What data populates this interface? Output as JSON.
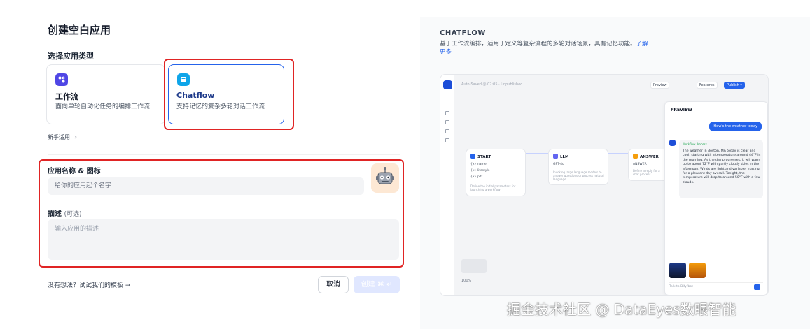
{
  "left": {
    "title": "创建空白应用",
    "type_label": "选择应用类型",
    "cards": [
      {
        "name": "工作流",
        "desc": "面向单轮自动化任务的编排工作流",
        "icon": "workflow-icon",
        "selected": false
      },
      {
        "name": "Chatflow",
        "desc": "支持记忆的复杂多轮对话工作流",
        "icon": "chatflow-icon",
        "selected": true
      }
    ],
    "beginner": "新手适用",
    "name_label": "应用名称 & 图标",
    "name_placeholder": "给你的应用起个名字",
    "avatar_icon": "robot-icon",
    "desc_label": "描述",
    "desc_optional": "(可选)",
    "desc_placeholder": "输入应用的描述",
    "template_link": "没有想法？试试我们的模板 →",
    "cancel": "取消",
    "create": "创建 ⌘ ↵"
  },
  "right": {
    "title": "CHATFLOW",
    "desc": "基于工作流编排，适用于定义等复杂流程的多轮对话场景，具有记忆功能。",
    "learn_more": "了解更多",
    "preview": {
      "saved": "Auto-Saved @ 02:05 · Unpublished",
      "preview_btn": "Preview",
      "features_btn": "Features",
      "publish_btn": "Publish ▾",
      "nodes": [
        {
          "title": "START",
          "rows": [
            "{x} name",
            "{x} lifestyle",
            "{x} pdf"
          ],
          "sub": "Define the initial parameters for launching a workflow"
        },
        {
          "title": "LLM",
          "rows": [
            "GPT-4o"
          ],
          "sub": "Invoking large language models to answer questions or process natural language"
        },
        {
          "title": "ANSWER",
          "rows": [
            "ANSWER"
          ],
          "sub": "Define a reply for a chat process"
        }
      ],
      "panel_title": "PREVIEW",
      "user_msg": "How's the weather today",
      "workflow_label": "Workflow Process",
      "bot_msg": "The weather in Boston, MA today is clear and cool, starting with a temperature around 44°F in the morning. As the day progresses, it will warm up to about 72°F with partly cloudy skies in the afternoon. Winds are light and variable, making for a pleasant day overall. Tonight, the temperature will drop to around 50°F with a few clouds.",
      "chat_placeholder": "Talk to Difyfbot",
      "zoom": "100%"
    }
  },
  "watermark": "掘金技术社区 @ DataEyes数眼智能",
  "colors": {
    "accent": "#2563eb",
    "highlight": "#e02424",
    "workflow": "#4f46e5",
    "chatflow": "#0ea5e9"
  }
}
